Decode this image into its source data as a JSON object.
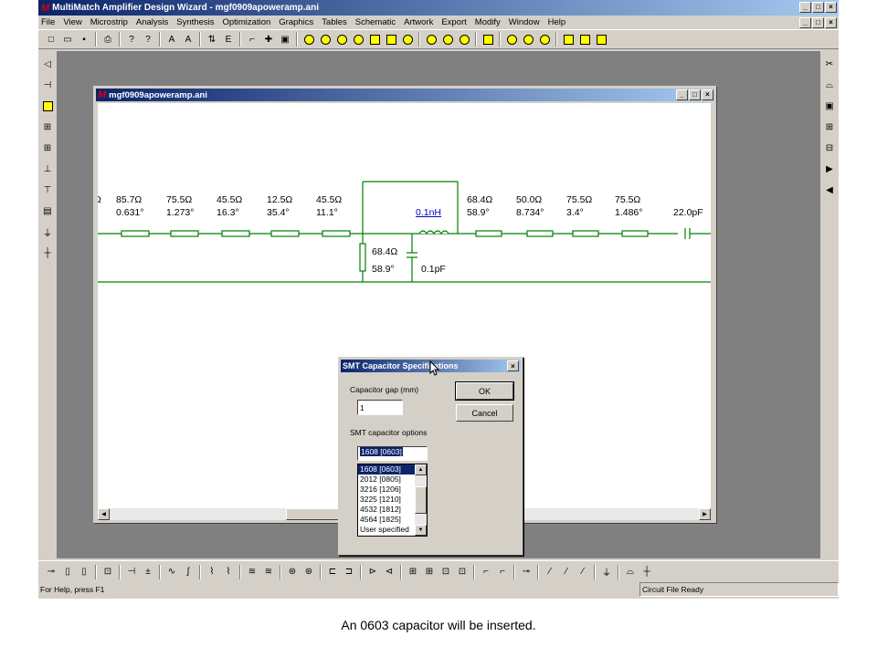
{
  "app": {
    "title": "MultiMatch Amplifier Design Wizard - mgf0909apoweramp.ani",
    "logo": "M",
    "min_glyph": "_",
    "max_glyph": "□",
    "close_glyph": "×"
  },
  "menu": [
    "File",
    "View",
    "Microstrip",
    "Analysis",
    "Synthesis",
    "Optimization",
    "Graphics",
    "Tables",
    "Schematic",
    "Artwork",
    "Export",
    "Modify",
    "Window",
    "Help"
  ],
  "toolbar_icons": [
    "new-file-icon",
    "open-folder-icon",
    "save-icon",
    "print-icon",
    "help-icon",
    "context-help-icon",
    "arrow-icon",
    "arrow-icon",
    "swap-icon",
    "e-icon",
    "wire-icon",
    "cross-icon",
    "box-icon"
  ],
  "toolbar_glyphs": [
    "□",
    "▭",
    "▪",
    "⎙",
    "?",
    "?",
    "A",
    "A",
    "⇅",
    "E",
    "⌐",
    "✚",
    "▣"
  ],
  "child_window": {
    "title": "mgf0909apoweramp.ani",
    "logo": "M"
  },
  "circuit": {
    "series_elements": [
      {
        "impedance": "85.7Ω",
        "length": "0.631°"
      },
      {
        "impedance": "75.5Ω",
        "length": "1.273°"
      },
      {
        "impedance": "45.5Ω",
        "length": "16.3°"
      },
      {
        "impedance": "12.5Ω",
        "length": "35.4°"
      },
      {
        "impedance": "45.5Ω",
        "length": "11.1°"
      }
    ],
    "inductor": "0.1nH",
    "line_after_inductor": {
      "impedance": "68.4Ω",
      "length": "58.9°"
    },
    "series_elements_right": [
      {
        "impedance": "50.0Ω",
        "length": "8.734°"
      },
      {
        "impedance": "75.5Ω",
        "length": "3.4°"
      },
      {
        "impedance": "75.5Ω",
        "length": "1.486°"
      }
    ],
    "output_cap": "22.0pF",
    "shunt_stub": {
      "impedance": "68.4Ω",
      "length": "58.9°"
    },
    "shunt_cap": "0.1pF",
    "partial_left": "Ω"
  },
  "dialog": {
    "title": "SMT Capacitor Specifications",
    "gap_label": "Capacitor gap (mm)",
    "gap_value": "1",
    "options_label": "SMT capacitor options",
    "selected": "1608 [0603]",
    "ok": "OK",
    "cancel": "Cancel",
    "options": [
      "1608 [0603]",
      "2012 [0805]",
      "3216 [1206]",
      "3225 [1210]",
      "4532 [1812]",
      "4564 [1825]",
      "User specified"
    ]
  },
  "status": {
    "help": "For Help, press F1",
    "state": "Circuit File Ready"
  },
  "caption": "An 0603 capacitor will be inserted."
}
